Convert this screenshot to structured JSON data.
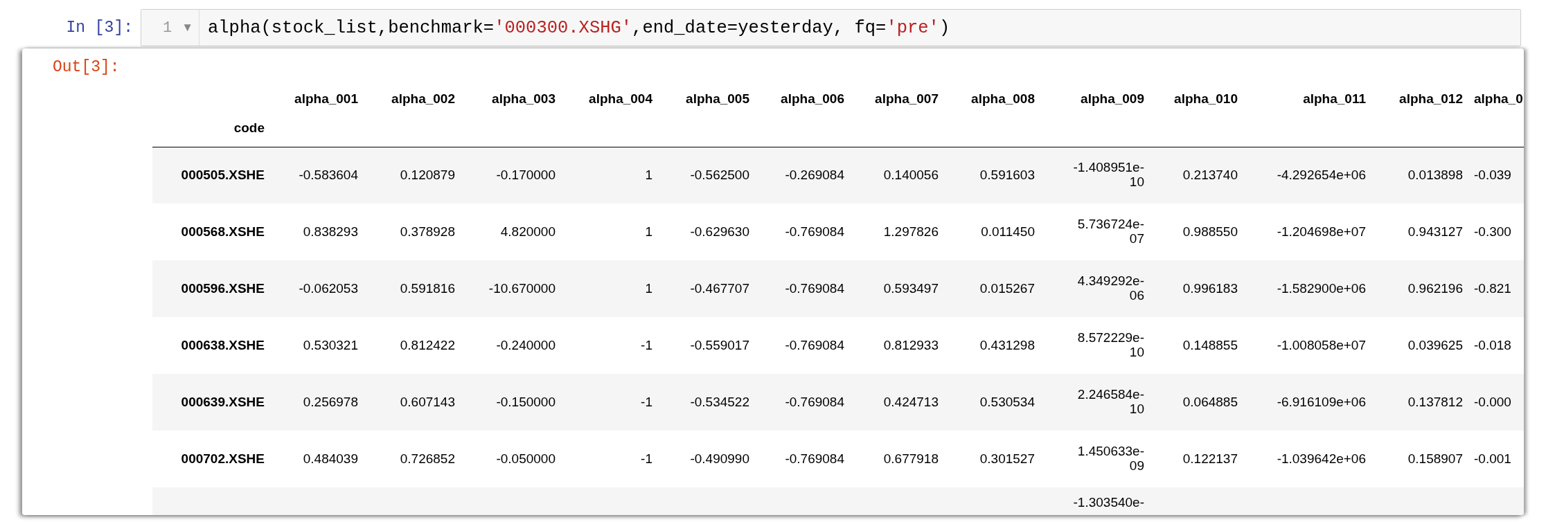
{
  "input_cell": {
    "prompt": "In [3]:",
    "line_number": "1",
    "fold_marker": "▼",
    "code": [
      {
        "kind": "plain",
        "text": "alpha(stock_list,benchmark="
      },
      {
        "kind": "string",
        "text": "'000300.XSHG'"
      },
      {
        "kind": "plain",
        "text": ",end_date=yesterday, fq="
      },
      {
        "kind": "string",
        "text": "'pre'"
      },
      {
        "kind": "plain",
        "text": ")"
      }
    ]
  },
  "output_cell": {
    "prompt": "Out[3]:",
    "table": {
      "index_name": "code",
      "columns": [
        "alpha_001",
        "alpha_002",
        "alpha_003",
        "alpha_004",
        "alpha_005",
        "alpha_006",
        "alpha_007",
        "alpha_008",
        "alpha_009",
        "alpha_010",
        "alpha_011",
        "alpha_012",
        "alpha_0"
      ],
      "rows": [
        {
          "index": "000505.XSHE",
          "cells": [
            "-0.583604",
            "0.120879",
            "-0.170000",
            "1",
            "-0.562500",
            "-0.269084",
            "0.140056",
            "0.591603",
            "-1.408951e-10",
            "0.213740",
            "-4.292654e+06",
            "0.013898",
            "-0.039"
          ]
        },
        {
          "index": "000568.XSHE",
          "cells": [
            "0.838293",
            "0.378928",
            "4.820000",
            "1",
            "-0.629630",
            "-0.769084",
            "1.297826",
            "0.011450",
            "5.736724e-07",
            "0.988550",
            "-1.204698e+07",
            "0.943127",
            "-0.300"
          ]
        },
        {
          "index": "000596.XSHE",
          "cells": [
            "-0.062053",
            "0.591816",
            "-10.670000",
            "1",
            "-0.467707",
            "-0.769084",
            "0.593497",
            "0.015267",
            "4.349292e-06",
            "0.996183",
            "-1.582900e+06",
            "0.962196",
            "-0.821"
          ]
        },
        {
          "index": "000638.XSHE",
          "cells": [
            "0.530321",
            "0.812422",
            "-0.240000",
            "-1",
            "-0.559017",
            "-0.769084",
            "0.812933",
            "0.431298",
            "8.572229e-10",
            "0.148855",
            "-1.008058e+07",
            "0.039625",
            "-0.018"
          ]
        },
        {
          "index": "000639.XSHE",
          "cells": [
            "0.256978",
            "0.607143",
            "-0.150000",
            "-1",
            "-0.534522",
            "-0.769084",
            "0.424713",
            "0.530534",
            "2.246584e-10",
            "0.064885",
            "-6.916109e+06",
            "0.137812",
            "-0.000"
          ]
        },
        {
          "index": "000702.XSHE",
          "cells": [
            "0.484039",
            "0.726852",
            "-0.050000",
            "-1",
            "-0.490990",
            "-0.769084",
            "0.677918",
            "0.301527",
            "1.450633e-09",
            "0.122137",
            "-1.039642e+06",
            "0.158907",
            "-0.001"
          ]
        },
        {
          "index": null,
          "cells": [
            null,
            null,
            null,
            null,
            null,
            null,
            null,
            null,
            "-1.303540e-",
            null,
            null,
            null,
            null
          ]
        }
      ]
    }
  }
}
